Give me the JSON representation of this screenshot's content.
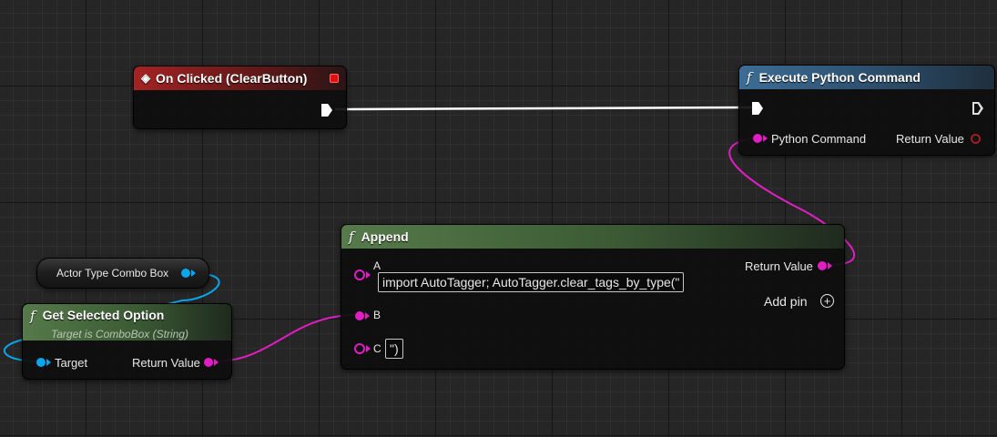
{
  "nodes": {
    "on_clicked": {
      "title": "On Clicked (ClearButton)",
      "header_color": "#a42323"
    },
    "execute_python": {
      "title": "Execute Python Command",
      "header_color": "#3c6d96",
      "pins": {
        "python_command": "Python Command",
        "return_value": "Return Value"
      }
    },
    "append": {
      "title": "Append",
      "header_color": "#567a4a",
      "pins": {
        "a": "A",
        "a_value": "import AutoTagger; AutoTagger.clear_tags_by_type(\"",
        "b": "B",
        "c": "C",
        "c_value": "\")",
        "return_value": "Return Value",
        "add_pin": "Add pin"
      }
    },
    "combo_var": {
      "title": "Actor Type Combo Box"
    },
    "get_selected": {
      "title": "Get Selected Option",
      "subtitle": "Target is ComboBox (String)",
      "header_color": "#567a4a",
      "pins": {
        "target": "Target",
        "return_value": "Return Value"
      }
    }
  },
  "colors": {
    "string_pin": "#e01ec4",
    "object_pin": "#0aa6ee",
    "exec_wire": "#ffffff"
  },
  "icons": {
    "event": "event-diamond-icon",
    "function": "function-f-icon",
    "add": "add-circle-icon"
  }
}
